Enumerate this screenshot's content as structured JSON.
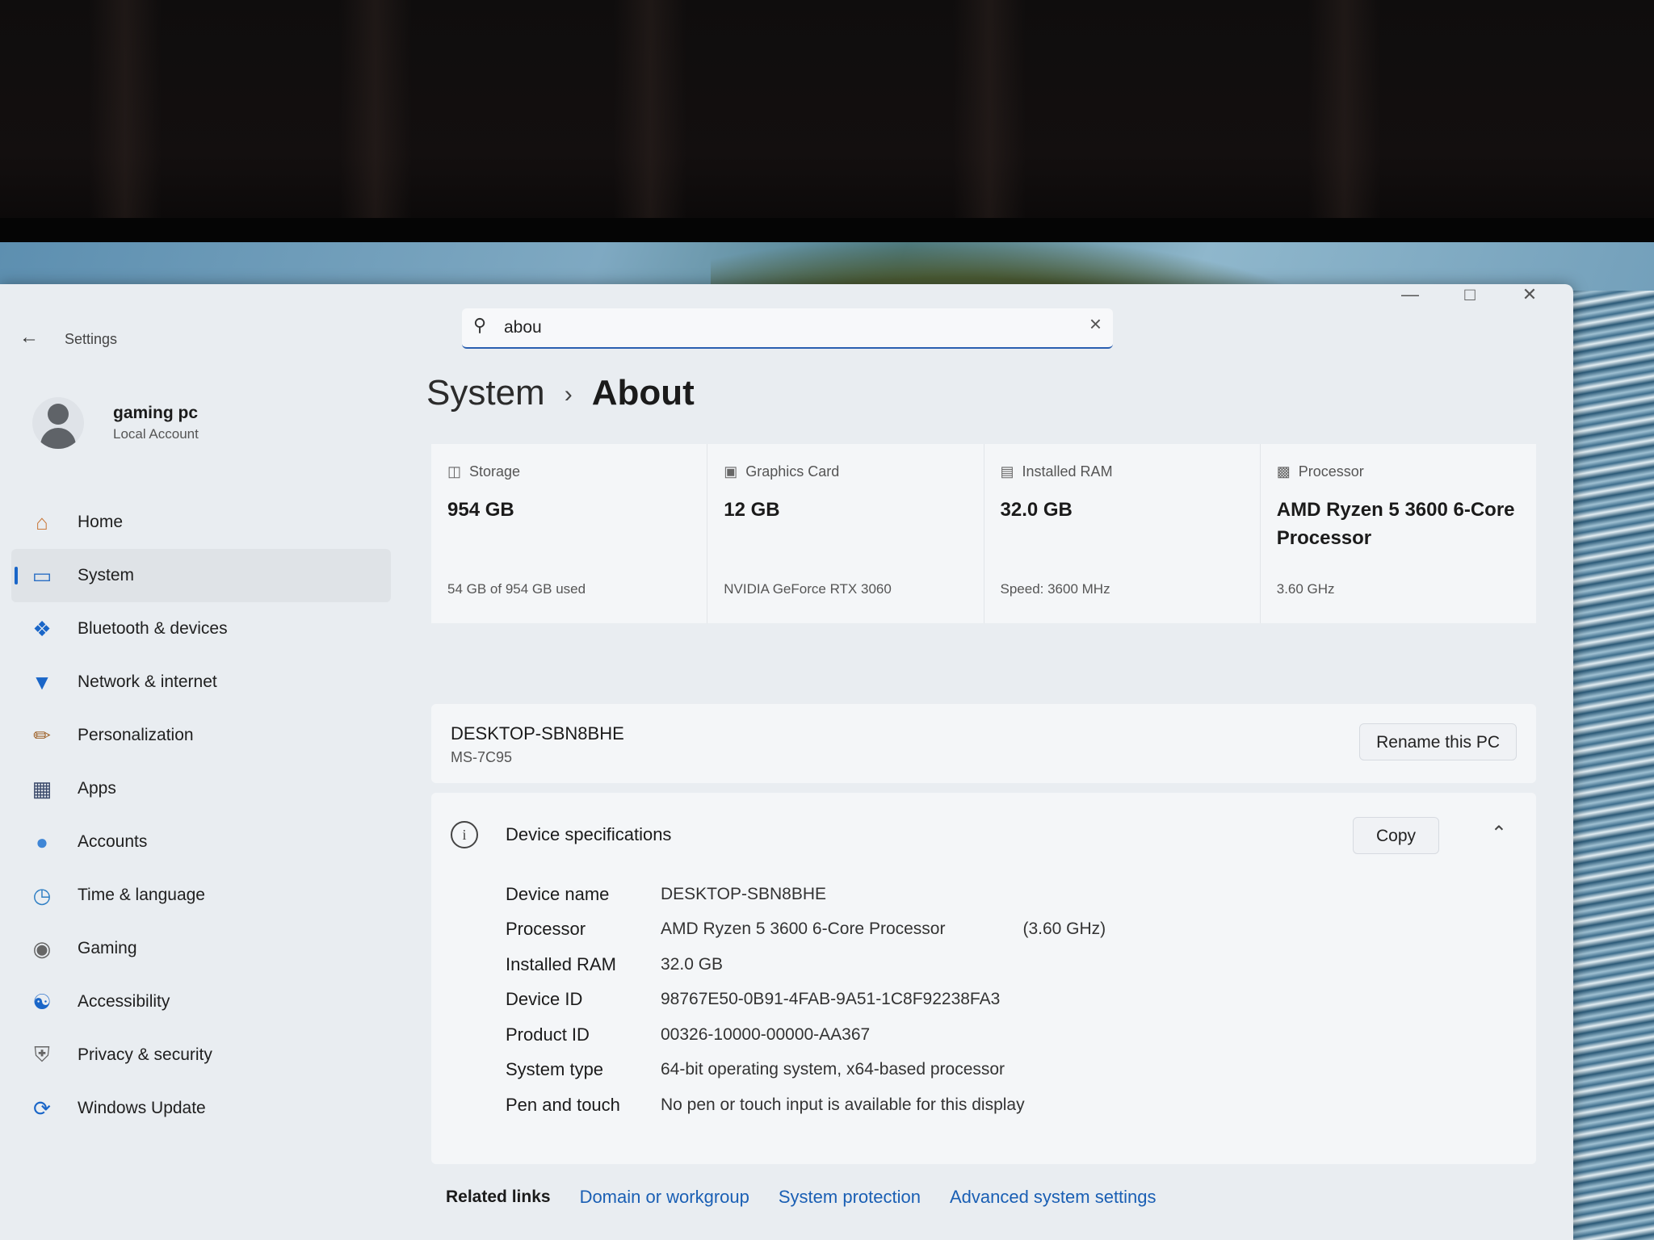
{
  "window": {
    "app_title": "Settings"
  },
  "search": {
    "value": "abou"
  },
  "profile": {
    "name": "gaming pc",
    "account_type": "Local Account"
  },
  "sidebar": {
    "items": [
      {
        "label": "Home",
        "icon": "home-icon"
      },
      {
        "label": "System",
        "icon": "system-icon",
        "active": true
      },
      {
        "label": "Bluetooth & devices",
        "icon": "bluetooth-icon"
      },
      {
        "label": "Network & internet",
        "icon": "wifi-icon"
      },
      {
        "label": "Personalization",
        "icon": "brush-icon"
      },
      {
        "label": "Apps",
        "icon": "apps-icon"
      },
      {
        "label": "Accounts",
        "icon": "person-icon"
      },
      {
        "label": "Time & language",
        "icon": "globe-clock-icon"
      },
      {
        "label": "Gaming",
        "icon": "gamepad-icon"
      },
      {
        "label": "Accessibility",
        "icon": "accessibility-icon"
      },
      {
        "label": "Privacy & security",
        "icon": "shield-icon"
      },
      {
        "label": "Windows Update",
        "icon": "update-icon"
      }
    ]
  },
  "breadcrumb": {
    "parent": "System",
    "current": "About"
  },
  "cards": [
    {
      "label": "Storage",
      "value": "954 GB",
      "sub": "54 GB of 954 GB used",
      "icon": "storage-icon"
    },
    {
      "label": "Graphics Card",
      "value": "12 GB",
      "sub": "NVIDIA GeForce RTX 3060",
      "icon": "graphics-card-icon"
    },
    {
      "label": "Installed RAM",
      "value": "32.0 GB",
      "sub": "Speed: 3600 MHz",
      "icon": "ram-icon"
    },
    {
      "label": "Processor",
      "value": "AMD Ryzen 5 3600 6-Core Processor",
      "sub": "3.60 GHz",
      "icon": "processor-icon"
    }
  ],
  "pc": {
    "name": "DESKTOP-SBN8BHE",
    "model": "MS-7C95",
    "rename_label": "Rename this PC"
  },
  "device_specs": {
    "title": "Device specifications",
    "copy_label": "Copy",
    "rows": [
      {
        "label": "Device name",
        "value": "DESKTOP-SBN8BHE",
        "extra": ""
      },
      {
        "label": "Processor",
        "value": "AMD Ryzen 5 3600 6-Core Processor",
        "extra": "(3.60 GHz)"
      },
      {
        "label": "Installed RAM",
        "value": "32.0 GB",
        "extra": ""
      },
      {
        "label": "Device ID",
        "value": "98767E50-0B91-4FAB-9A51-1C8F92238FA3",
        "extra": ""
      },
      {
        "label": "Product ID",
        "value": "00326-10000-00000-AA367",
        "extra": ""
      },
      {
        "label": "System type",
        "value": "64-bit operating system, x64-based processor",
        "extra": ""
      },
      {
        "label": "Pen and touch",
        "value": "No pen or touch input is available for this display",
        "extra": ""
      }
    ]
  },
  "related": {
    "label": "Related links",
    "links": [
      "Domain or workgroup",
      "System protection",
      "Advanced system settings"
    ]
  },
  "colors": {
    "accent": "#1a66c8",
    "link": "#1a5fb4",
    "window_bg": "#e9edf1"
  }
}
